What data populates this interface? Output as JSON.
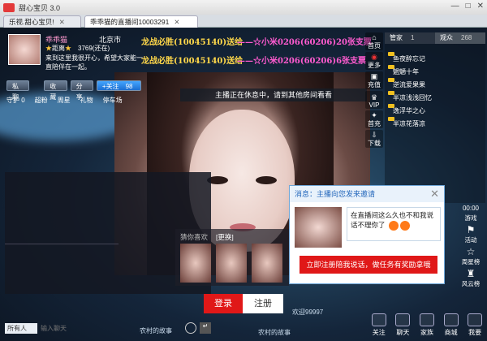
{
  "app": {
    "title": "甜心宝贝 3.0"
  },
  "tabs": [
    {
      "label": "乐视.甜心宝贝!"
    },
    {
      "label": "乖乖猫的直播间10003291"
    }
  ],
  "anchor": {
    "name": "乖乖猫",
    "city": "北京市",
    "level_label": "距离",
    "score": "3769(还在)",
    "intro": "来到这里我很开心，希望大家能一直陪伴在一起。",
    "buttons": {
      "private_chat": "私聊",
      "favorite": "收藏",
      "share": "分享",
      "follow": "+关注",
      "follow_count": "98"
    },
    "stats": {
      "guard": "守护 0",
      "fans": "超粉",
      "weekly": "周星",
      "gifts": "礼物",
      "parking": "停车场"
    }
  },
  "danmaku": [
    {
      "text": "龙战必胜(10045140)送给"
    },
    {
      "text": "——☆小米0206(60206)20张支票"
    },
    {
      "text": "龙战必胜(10045140)送给"
    },
    {
      "text": "——☆小米0206(60206)6张支票"
    }
  ],
  "notice": "主播正在休息中，请到其他房间看看",
  "rnav": [
    {
      "label": "首页",
      "icon": "home-icon"
    },
    {
      "label": "更多",
      "icon": "eye-icon"
    },
    {
      "label": "充值",
      "icon": "recharge-icon"
    },
    {
      "label": "VIP",
      "icon": "vip-icon"
    },
    {
      "label": "首充",
      "icon": "firstpay-icon"
    },
    {
      "label": "下载",
      "icon": "download-icon"
    }
  ],
  "userlist": {
    "tabs": [
      {
        "label": "管家",
        "count": "1"
      },
      {
        "label": "观众",
        "count": "268"
      }
    ],
    "users": [
      "鱼夜醉忘记",
      "魍魉十年",
      "逆流爱果果",
      "半凉浅浅回忆",
      "逸浮华之心",
      "半凉花落凉"
    ]
  },
  "sidebar_right": [
    {
      "label": "游戏",
      "icon": "game-icon"
    },
    {
      "label": "活动",
      "icon": "activity-icon"
    },
    {
      "label": "周星榜",
      "icon": "weekly-star-icon"
    },
    {
      "label": "风云榜",
      "icon": "ranking-icon"
    }
  ],
  "time": "00:00",
  "guess": {
    "title": "猜你喜欢",
    "refresh": "[更换]"
  },
  "auth": {
    "login": "登录",
    "register": "注册"
  },
  "popup": {
    "title": "消息：主播向您发来邀请",
    "message": "在直播间这么久也不和我说话不理你了",
    "cta": "立即注册陪我说话，做任务有奖励拿哦"
  },
  "chat": {
    "target": "所有人",
    "placeholder": "输入聊天"
  },
  "bottom_bar": [
    {
      "label": "关注",
      "icon": "follow-icon"
    },
    {
      "label": "聊天",
      "icon": "chat-icon"
    },
    {
      "label": "家族",
      "icon": "family-icon"
    },
    {
      "label": "商城",
      "icon": "shop-icon"
    },
    {
      "label": "我要",
      "icon": "me-icon"
    }
  ],
  "overlay_texts": {
    "a": "欢迎99997",
    "b": "农村的故事",
    "c": "农村的故事"
  }
}
